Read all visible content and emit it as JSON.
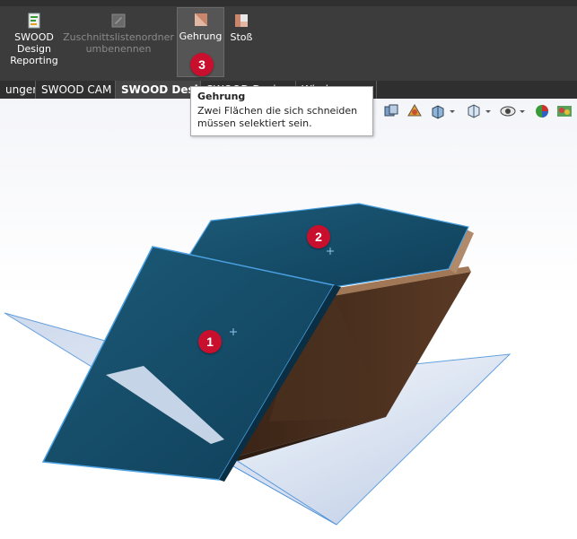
{
  "ribbon": {
    "buttons": [
      {
        "label": "SWOOD\nDesign\nReporting",
        "icon": "report-icon",
        "enabled": true
      },
      {
        "label": "Zuschnittslistenordner\numbenennen",
        "icon": "folder-rename-icon",
        "enabled": false
      },
      {
        "label": "Gehrung",
        "icon": "miter-icon",
        "enabled": true,
        "active": true
      },
      {
        "label": "Stoß",
        "icon": "butt-joint-icon",
        "enabled": true
      }
    ]
  },
  "tabs": [
    {
      "label": "ungen"
    },
    {
      "label": "SWOOD CAM"
    },
    {
      "label": "SWOOD Design",
      "active": true
    },
    {
      "label": "SWOOD Desig"
    },
    {
      "label": "Wieder"
    }
  ],
  "tooltip": {
    "title": "Gehrung",
    "text": "Zwei Flächen die sich schneiden müssen selektiert sein."
  },
  "badges": [
    "1",
    "2",
    "3"
  ],
  "colors": {
    "ribbon_bg": "#3c3c3c",
    "tab_bg": "#2f2f2f",
    "badge": "#c8102e",
    "selected_face": "#134a66",
    "plane": "#b9cbe6",
    "wood": "#4a3020"
  }
}
